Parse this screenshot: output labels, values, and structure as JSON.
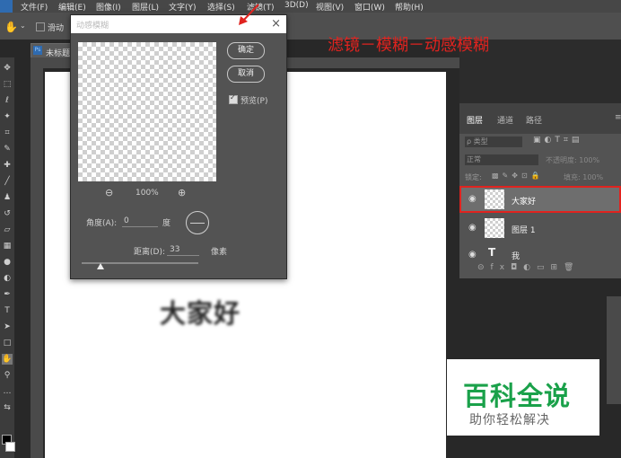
{
  "menubar": {
    "items": [
      "文件(F)",
      "编辑(E)",
      "图像(I)",
      "图层(L)",
      "文字(Y)",
      "选择(S)",
      "滤镜(T)",
      "3D(D)",
      "视图(V)",
      "窗口(W)",
      "帮助(H)"
    ]
  },
  "optionsbar": {
    "partial_label": "滑动"
  },
  "document": {
    "tab_label": "未标题",
    "canvas_text": "大家好"
  },
  "dialog": {
    "title": "动感模糊",
    "ok_label": "确定",
    "cancel_label": "取消",
    "preview_label": "预览(P)",
    "preview_checked": true,
    "zoom_out": "⊖",
    "zoom_value": "100%",
    "zoom_in": "⊕",
    "angle_label": "角度(A):",
    "angle_value": "0",
    "angle_unit": "度",
    "distance_label": "距离(D):",
    "distance_value": "33",
    "distance_unit": "像素",
    "distance_slider_fraction": 0.165
  },
  "annotation": {
    "text": "滤镜－模糊－动感模糊",
    "color": "#e0231f"
  },
  "layers_panel": {
    "tabs": [
      "图层",
      "通道",
      "路径"
    ],
    "filter_label": "ρ 类型",
    "blend_mode": "正常",
    "opacity_label": "不透明度: 100%",
    "lock_label": "锁定:",
    "fill_label": "填充: 100%",
    "layers": [
      {
        "name": "大家好",
        "selected": true
      },
      {
        "name": "图层 1",
        "selected": false
      },
      {
        "name": "我",
        "selected": false
      }
    ]
  },
  "watermark": {
    "title": "百科全说",
    "subtitle": "助你轻松解决",
    "color": "#1aa14a"
  }
}
